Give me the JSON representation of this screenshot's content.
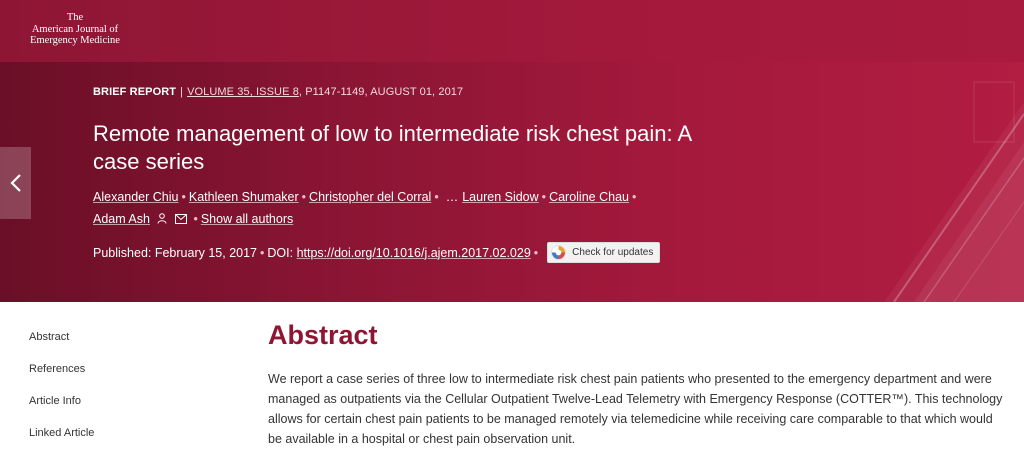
{
  "journal": {
    "logo_lines": [
      "The",
      "American Journal of",
      "Emergency Medicine"
    ]
  },
  "article": {
    "type": "BRIEF REPORT",
    "separator": "|",
    "volume_issue": "VOLUME 35, ISSUE 8",
    "pages_date": ", P1147-1149, AUGUST 01, 2017",
    "title": "Remote management of low to intermediate risk chest pain: A case series",
    "authors": [
      "Alexander Chiu",
      "Kathleen Shumaker",
      "Christopher del Corral",
      "Lauren Sidow",
      "Caroline Chau",
      "Adam Ash"
    ],
    "ellipsis": "…",
    "show_all_label": "Show all authors",
    "published_label": "Published: February 15, 2017",
    "doi_label": "DOI:",
    "doi_url": "https://doi.org/10.1016/j.ajem.2017.02.029",
    "check_updates_label": "Check for updates"
  },
  "sidenav": {
    "items": [
      "Abstract",
      "References",
      "Article Info",
      "Linked Article"
    ]
  },
  "abstract": {
    "heading": "Abstract",
    "text": "We report a case series of three low to intermediate risk chest pain patients who presented to the emergency department and were managed as outpatients via the Cellular Outpatient Twelve-Lead Telemetry with Emergency Response (COTTER™). This technology allows for certain chest pain patients to be managed remotely via telemedicine while receiving care comparable to that which would be available in a hospital or chest pain observation unit."
  },
  "colors": {
    "brand": "#a3193c",
    "heading": "#8e1634"
  },
  "icons": {
    "prev": "chevron-left-icon",
    "person": "person-icon",
    "email": "envelope-icon",
    "crossmark": "crossmark-icon"
  }
}
